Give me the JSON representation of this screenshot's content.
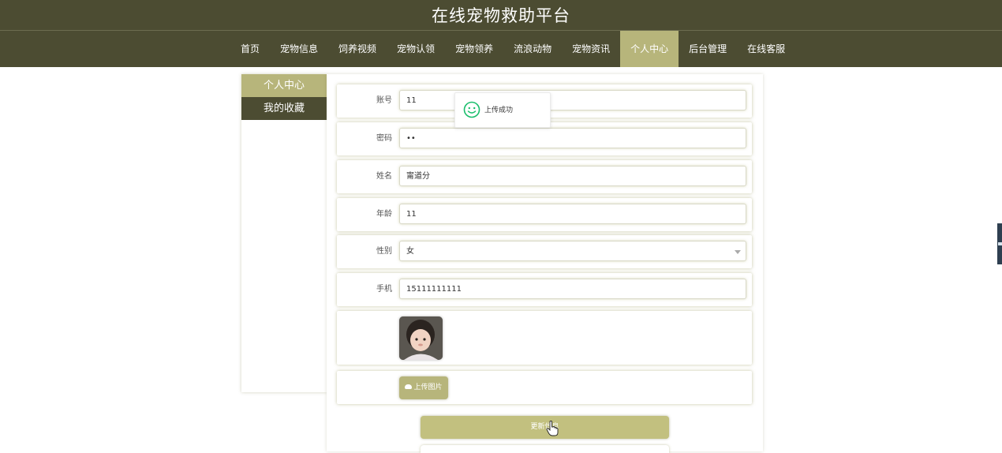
{
  "site": {
    "title": "在线宠物救助平台"
  },
  "nav": {
    "items": [
      {
        "label": "首页"
      },
      {
        "label": "宠物信息"
      },
      {
        "label": "饲养视频"
      },
      {
        "label": "宠物认领"
      },
      {
        "label": "宠物领养"
      },
      {
        "label": "流浪动物"
      },
      {
        "label": "宠物资讯"
      },
      {
        "label": "个人中心"
      },
      {
        "label": "后台管理"
      },
      {
        "label": "在线客服"
      }
    ],
    "active": "个人中心"
  },
  "sidebar": {
    "items": [
      {
        "label": "个人中心"
      },
      {
        "label": "我的收藏"
      }
    ]
  },
  "form": {
    "account": {
      "label": "账号",
      "value": "11"
    },
    "password": {
      "label": "密码",
      "value": "••"
    },
    "name": {
      "label": "姓名",
      "value": "甯道分"
    },
    "age": {
      "label": "年龄",
      "value": "11"
    },
    "gender": {
      "label": "性别",
      "value": "女"
    },
    "phone": {
      "label": "手机",
      "value": "15111111111"
    },
    "upload_label": "上传图片",
    "save_label": "更新信息"
  },
  "toast": {
    "message": "上传成功"
  },
  "colors": {
    "header": "#4c4c32",
    "accent": "#b7b57b",
    "toast_icon": "#19be6b"
  },
  "icons": [
    "smile-icon",
    "cloud-upload-icon",
    "chevron-down-icon",
    "hand-pointer-icon"
  ]
}
